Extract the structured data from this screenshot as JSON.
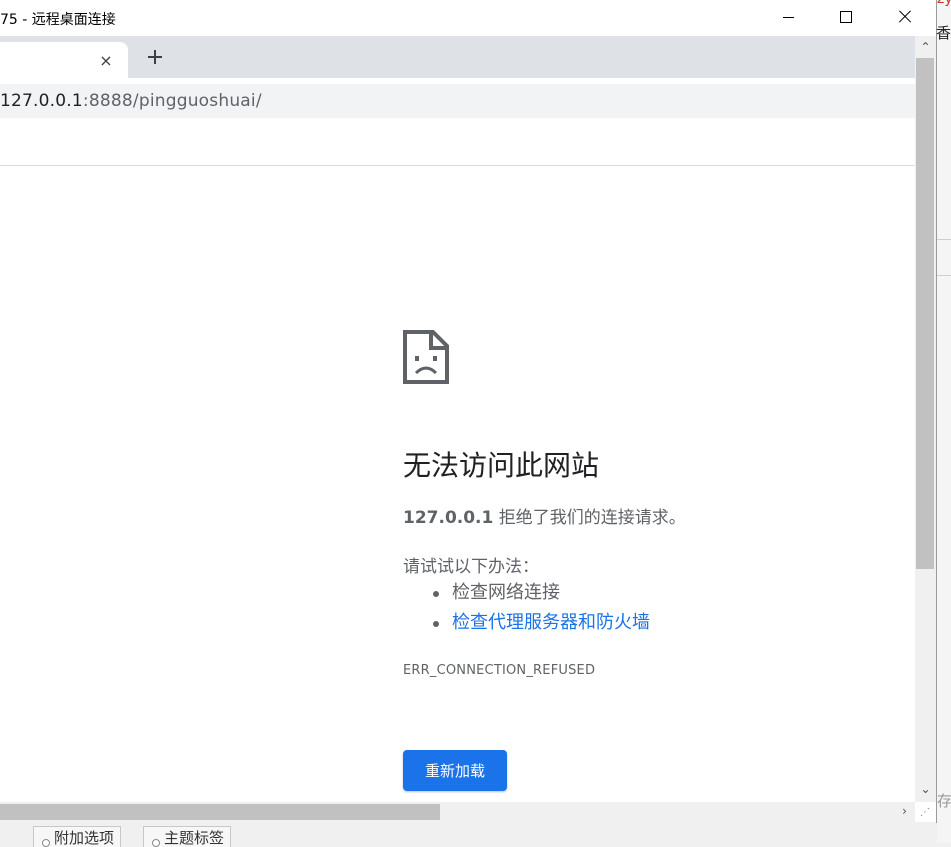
{
  "window": {
    "title": "75 - 远程桌面连接",
    "controls": {
      "minimize": "minimize",
      "maximize": "maximize",
      "close": "close"
    }
  },
  "browser": {
    "tab_close_glyph": "×",
    "address": {
      "host": "127.0.0.1",
      "path": ":8888/pingguoshuai/"
    }
  },
  "error_page": {
    "title": "无法访问此网站",
    "host": "127.0.0.1",
    "message": " 拒绝了我们的连接请求。",
    "try_heading": "请试试以下办法：",
    "suggestions": [
      "检查网络连接",
      "检查代理服务器和防火墙"
    ],
    "error_code": "ERR_CONNECTION_REFUSED",
    "reload_label": "重新加载"
  },
  "background": {
    "red_text": "zy",
    "char_top": "香",
    "char_bottom": "存",
    "tabs": [
      "附加选项",
      "主题标签"
    ]
  },
  "colors": {
    "accent": "#1a73e8",
    "tabstrip": "#dee1e6",
    "omnibox": "#f1f3f4",
    "text_secondary": "#5f6368"
  }
}
